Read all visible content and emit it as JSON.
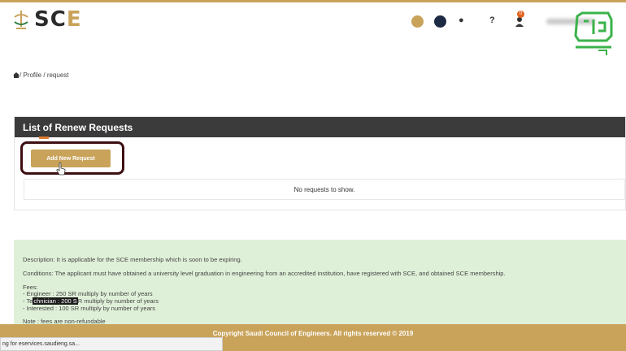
{
  "header": {
    "logo_text_main": "SC",
    "logo_text_accent": "E",
    "notifications_count": "0",
    "help_label": "?",
    "colors": {
      "gold": "#c9a35a",
      "navy": "#1d2a44",
      "dark": "#3b3b3b",
      "footer": "#c9a35a",
      "info_bg": "#dff0d8"
    }
  },
  "breadcrumb": {
    "separator_1": "/ ",
    "profile": "Profile",
    "separator_2": " / ",
    "request": "request"
  },
  "panel": {
    "title": "List of Renew Requests",
    "add_button_label": "Add New Request",
    "empty_message": "No requests to show."
  },
  "info": {
    "description": "Description: It is applicable for the SCE membership which is soon to be expiring.",
    "conditions": "Conditions: The applicant must have obtained a university level graduation in engineering from an accredited institution, have registered with SCE, and obtained SCE membership.",
    "fees_label": "Fees:",
    "fee_engineer": "- Engineer : 250 SR multiply by number of years",
    "fee_tech_prefix": "- Te",
    "fee_tech_highlight": "chnician : 200 S",
    "fee_tech_suffix": "R multiply by number of years",
    "fee_interested": "- Interested : 100 SR multiply by number of years",
    "note": "Note : fees are non-refundable"
  },
  "footer": {
    "copyright": "Copyright Saudi Council of Engineers. All rights reserved © 2019"
  },
  "status_bar": {
    "text": "ng for eservices.saudieng.sa..."
  },
  "icons": [
    "sce-emblem-icon",
    "theme-gold-icon",
    "theme-navy-icon",
    "globe-icon",
    "help-icon",
    "user-icon",
    "home-icon",
    "cursor-hand-icon",
    "watermark-logo-icon"
  ]
}
